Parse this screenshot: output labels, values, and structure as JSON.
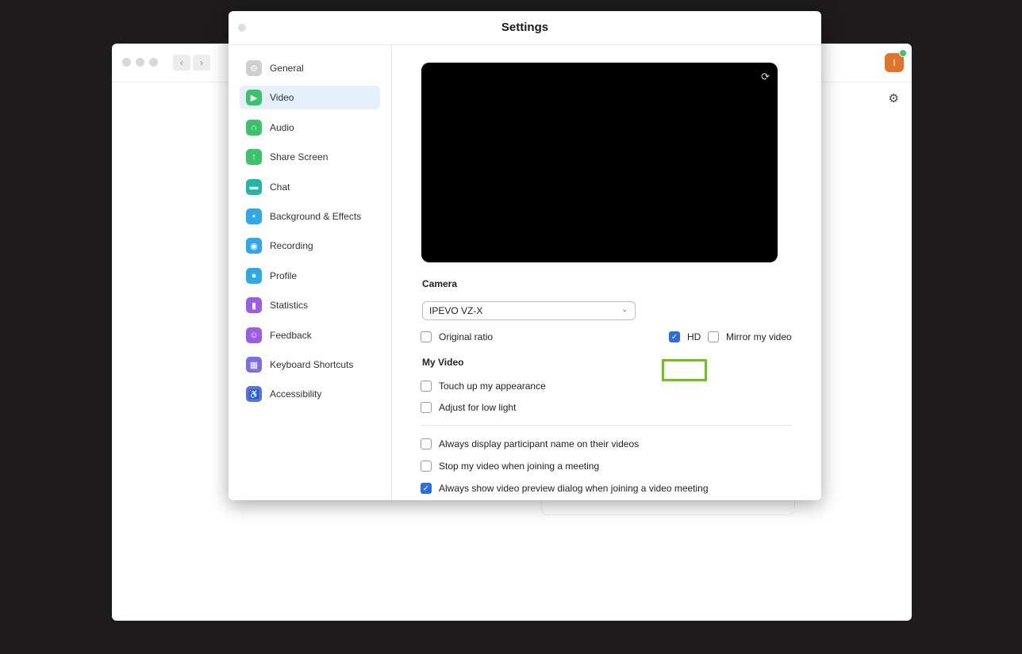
{
  "dialog": {
    "title": "Settings"
  },
  "sidebar": {
    "items": [
      {
        "label": "General",
        "icon": "gear-icon",
        "color": "#cfcfcf",
        "glyph": "⚙"
      },
      {
        "label": "Video",
        "icon": "video-camera-icon",
        "color": "#3cc26a",
        "glyph": "▶",
        "active": true
      },
      {
        "label": "Audio",
        "icon": "headphones-icon",
        "color": "#3cc26a",
        "glyph": "∩"
      },
      {
        "label": "Share Screen",
        "icon": "share-screen-icon",
        "color": "#3cc26a",
        "glyph": "↑"
      },
      {
        "label": "Chat",
        "icon": "chat-icon",
        "color": "#1fb7a8",
        "glyph": "▬"
      },
      {
        "label": "Background & Effects",
        "icon": "background-icon",
        "color": "#2ea8e6",
        "glyph": "▪"
      },
      {
        "label": "Recording",
        "icon": "recording-icon",
        "color": "#2ea8e6",
        "glyph": "◉"
      },
      {
        "label": "Profile",
        "icon": "profile-icon",
        "color": "#2ea8e6",
        "glyph": "●"
      },
      {
        "label": "Statistics",
        "icon": "statistics-icon",
        "color": "#9b5de5",
        "glyph": "▮"
      },
      {
        "label": "Feedback",
        "icon": "feedback-icon",
        "color": "#9b5de5",
        "glyph": "☺"
      },
      {
        "label": "Keyboard Shortcuts",
        "icon": "keyboard-icon",
        "color": "#7b6ee0",
        "glyph": "▦"
      },
      {
        "label": "Accessibility",
        "icon": "accessibility-icon",
        "color": "#5a6fe0",
        "glyph": "♿"
      }
    ]
  },
  "video": {
    "camera_heading": "Camera",
    "camera_selected": "IPEVO VZ-X",
    "original_ratio_label": "Original ratio",
    "original_ratio_checked": false,
    "hd_label": "HD",
    "hd_checked": true,
    "mirror_label": "Mirror my video",
    "mirror_checked": false,
    "my_video_heading": "My Video",
    "touch_up_label": "Touch up my appearance",
    "touch_up_checked": false,
    "low_light_label": "Adjust for low light",
    "low_light_checked": false,
    "display_names_label": "Always display participant name on their videos",
    "display_names_checked": false,
    "stop_video_label": "Stop my video when joining a meeting",
    "stop_video_checked": false,
    "preview_dialog_label": "Always show video preview dialog when joining a video meeting",
    "preview_dialog_checked": true
  },
  "app": {
    "avatar_initial": "I",
    "accent_color": "#2d6de2",
    "highlight_color": "#6cc417"
  }
}
